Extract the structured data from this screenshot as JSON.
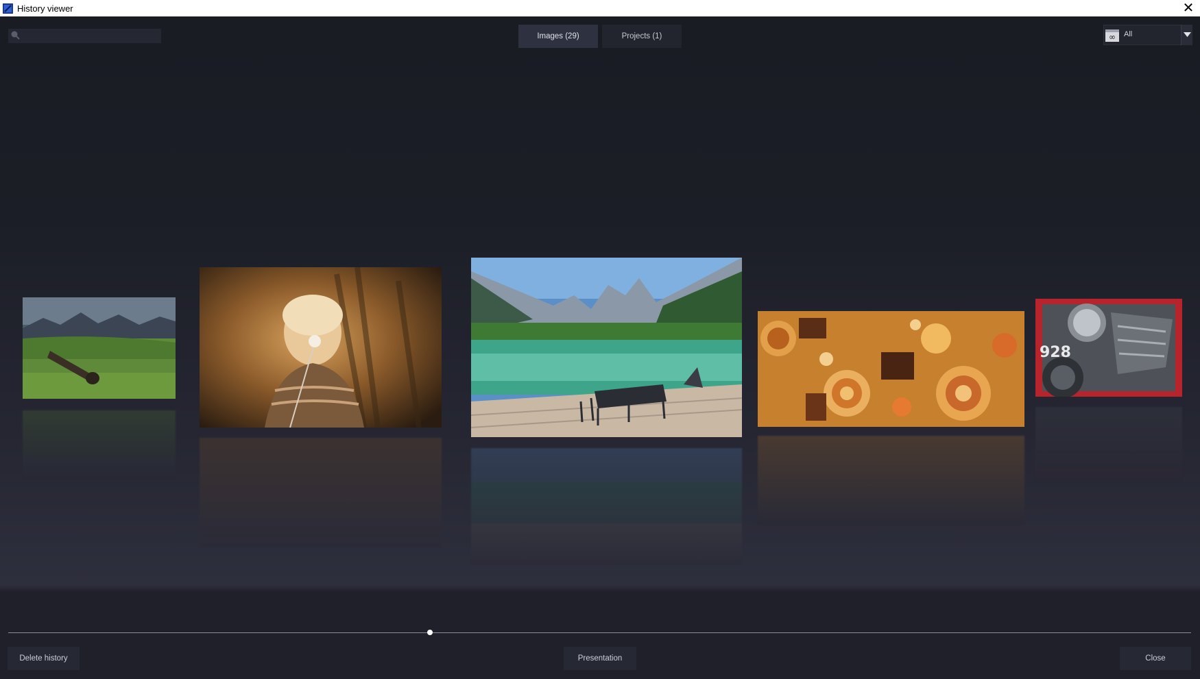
{
  "window": {
    "title": "History viewer"
  },
  "search": {
    "value": "",
    "placeholder": ""
  },
  "tabs": [
    {
      "label": "Images (29)",
      "active": true
    },
    {
      "label": "Projects (1)",
      "active": false
    }
  ],
  "filter": {
    "selected": "All",
    "icon": "infinity-calendar-icon"
  },
  "gallery": {
    "images": [
      {
        "name": "meadow-mountains-thumbnail"
      },
      {
        "name": "child-dandelion-thumbnail"
      },
      {
        "name": "mountain-lake-terrace-thumbnail"
      },
      {
        "name": "candy-lollipops-thumbnail"
      },
      {
        "name": "motorcycle-928-thumbnail",
        "plate_text": "928"
      }
    ]
  },
  "timeline": {
    "position": 0.355
  },
  "footer": {
    "delete_label": "Delete history",
    "presentation_label": "Presentation",
    "close_label": "Close"
  },
  "colors": {
    "background": "#1b1d26",
    "accent_active_tab": "#2e3140"
  }
}
